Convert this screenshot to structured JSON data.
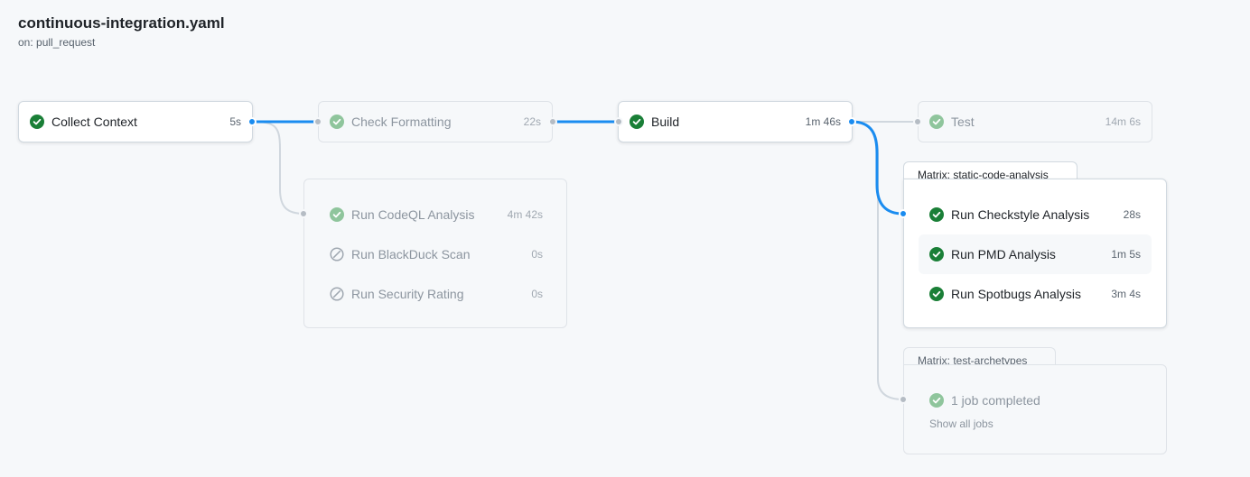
{
  "workflow": {
    "file_name": "continuous-integration.yaml",
    "trigger": "on: pull_request"
  },
  "colors": {
    "success": "#1a7f37",
    "success_faded": "#8fc59c",
    "connector_active": "#1a8cf0",
    "connector_idle": "#d0d7de"
  },
  "jobs": {
    "collect_context": {
      "name": "Collect Context",
      "duration": "5s",
      "status": "success",
      "icon": "check-circle-icon"
    },
    "check_formatting": {
      "name": "Check Formatting",
      "duration": "22s",
      "status": "success",
      "icon": "check-circle-icon"
    },
    "build": {
      "name": "Build",
      "duration": "1m 46s",
      "status": "success",
      "icon": "check-circle-icon"
    },
    "test": {
      "name": "Test",
      "duration": "14m 6s",
      "status": "success",
      "icon": "check-circle-icon"
    }
  },
  "security_group": {
    "items": [
      {
        "name": "Run CodeQL Analysis",
        "duration": "4m 42s",
        "status": "success",
        "icon": "check-circle-icon"
      },
      {
        "name": "Run BlackDuck Scan",
        "duration": "0s",
        "status": "skipped",
        "icon": "skipped-icon"
      },
      {
        "name": "Run Security Rating",
        "duration": "0s",
        "status": "skipped",
        "icon": "skipped-icon"
      }
    ]
  },
  "matrix_static": {
    "label": "Matrix: static-code-analysis",
    "items": [
      {
        "name": "Run Checkstyle Analysis",
        "duration": "28s",
        "status": "success",
        "icon": "check-circle-icon"
      },
      {
        "name": "Run PMD Analysis",
        "duration": "1m 5s",
        "status": "success",
        "icon": "check-circle-icon"
      },
      {
        "name": "Run Spotbugs Analysis",
        "duration": "3m 4s",
        "status": "success",
        "icon": "check-circle-icon"
      }
    ]
  },
  "matrix_archetypes": {
    "label": "Matrix: test-archetypes",
    "summary": "1 job completed",
    "show_all": "Show all jobs"
  }
}
